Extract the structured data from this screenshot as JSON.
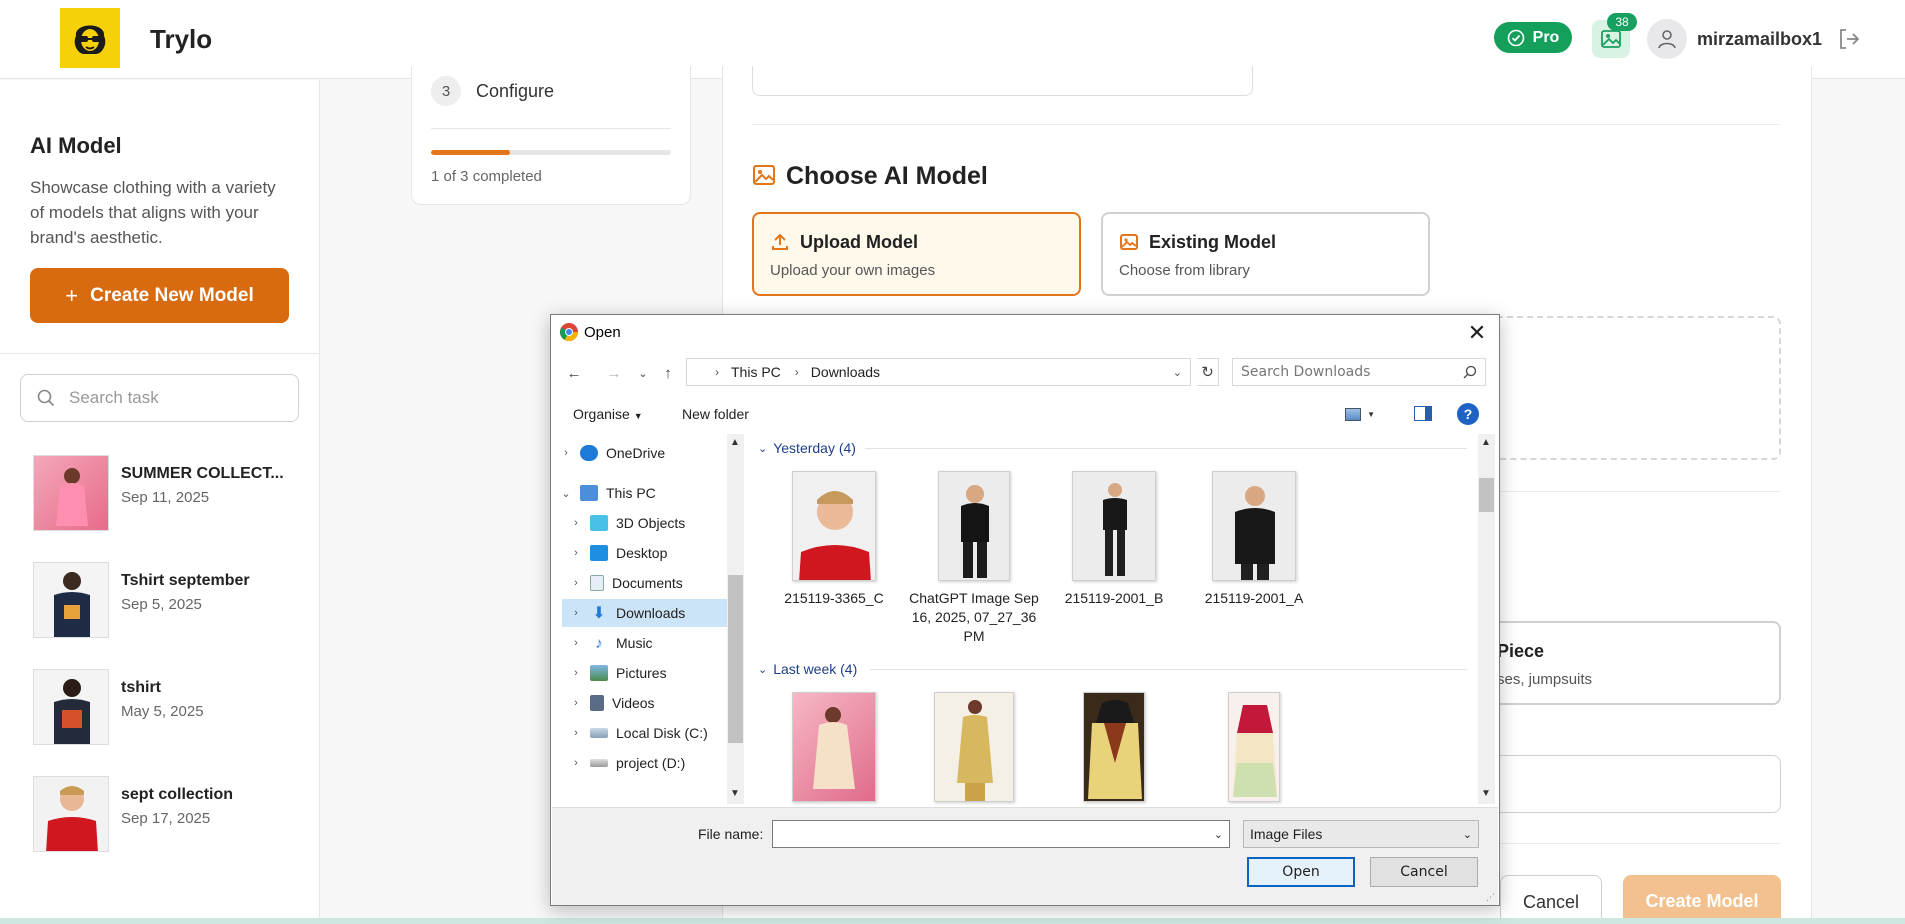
{
  "header": {
    "brand": "Trylo",
    "pro_label": "Pro",
    "gallery_count": "38",
    "username": "mirzamailbox1"
  },
  "sidebar": {
    "title": "AI Model",
    "description": "Showcase clothing with a variety of models that aligns with your brand's aesthetic.",
    "create_label": "Create New Model",
    "search_placeholder": "Search task",
    "tasks": [
      {
        "name": "SUMMER COLLECT...",
        "date": "Sep 11, 2025"
      },
      {
        "name": "Tshirt september",
        "date": "Sep 5, 2025"
      },
      {
        "name": "tshirt",
        "date": "May 5, 2025"
      },
      {
        "name": "sept collection",
        "date": "Sep 17, 2025"
      }
    ]
  },
  "stepper": {
    "step_number": "3",
    "step_label": "Configure",
    "progress_text": "1 of 3 completed",
    "progress_fraction": 0.33
  },
  "main": {
    "section_title": "Choose AI Model",
    "options": [
      {
        "title": "Upload Model",
        "subtitle": "Upload your own images",
        "active": true
      },
      {
        "title": "Existing Model",
        "subtitle": "Choose from library",
        "active": false
      }
    ],
    "piece_title": "Piece",
    "piece_sub": "ses, jumpsuits",
    "cancel_label": "Cancel",
    "create_label": "Create Model"
  },
  "dialog": {
    "title": "Open",
    "path": [
      "This PC",
      "Downloads"
    ],
    "search_placeholder": "Search Downloads",
    "toolbar": {
      "organise": "Organise",
      "new_folder": "New folder"
    },
    "tree": [
      {
        "label": "OneDrive",
        "icon": "cloud-icon"
      },
      {
        "label": "This PC",
        "icon": "computer-icon"
      },
      {
        "label": "3D Objects",
        "icon": "cube-icon"
      },
      {
        "label": "Desktop",
        "icon": "desktop-icon"
      },
      {
        "label": "Documents",
        "icon": "document-icon"
      },
      {
        "label": "Downloads",
        "icon": "download-icon"
      },
      {
        "label": "Music",
        "icon": "music-icon"
      },
      {
        "label": "Pictures",
        "icon": "pictures-icon"
      },
      {
        "label": "Videos",
        "icon": "video-icon"
      },
      {
        "label": "Local Disk (C:)",
        "icon": "disk-icon"
      },
      {
        "label": "project (D:)",
        "icon": "drive-icon"
      }
    ],
    "groups": [
      {
        "label": "Yesterday (4)",
        "files": [
          {
            "name": "215119-3365_C"
          },
          {
            "name": "ChatGPT Image Sep 16, 2025, 07_27_36 PM"
          },
          {
            "name": "215119-2001_B"
          },
          {
            "name": "215119-2001_A"
          }
        ]
      },
      {
        "label": "Last week (4)",
        "files": [
          {
            "name": ""
          },
          {
            "name": ""
          },
          {
            "name": ""
          },
          {
            "name": ""
          }
        ]
      }
    ],
    "file_name_label": "File name:",
    "file_name_value": "",
    "file_type": "Image Files",
    "open_label": "Open",
    "cancel_label": "Cancel"
  },
  "colors": {
    "accent": "#d86a10",
    "pro": "#14a05b",
    "selection": "#cce4f7",
    "primary_button_border": "#0a64c8"
  }
}
